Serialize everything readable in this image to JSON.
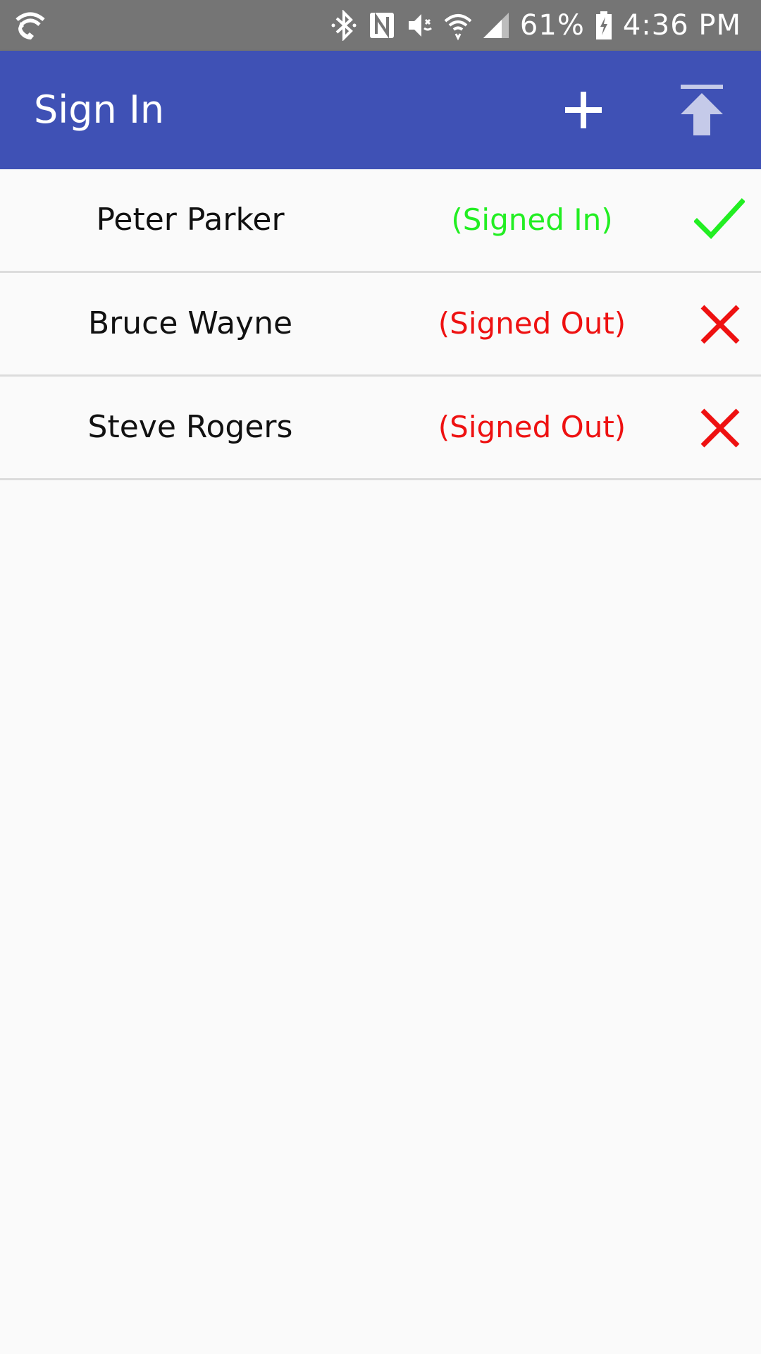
{
  "status_bar": {
    "battery": "61%",
    "time": "4:36 PM",
    "icons": [
      "wifi-calling-icon",
      "bluetooth-icon",
      "nfc-icon",
      "vibrate-icon",
      "wifi-icon",
      "signal-icon",
      "battery-charging-icon"
    ]
  },
  "app_bar": {
    "title": "Sign In",
    "actions": [
      "add-icon",
      "upload-icon"
    ],
    "color": "#3f51b5"
  },
  "people": [
    {
      "name": "Peter Parker",
      "status": "(Signed In)",
      "status_color": "#22ee22",
      "icon": "check-icon"
    },
    {
      "name": "Bruce Wayne",
      "status": "(Signed Out)",
      "status_color": "#ee1111",
      "icon": "close-icon"
    },
    {
      "name": "Steve Rogers",
      "status": "(Signed Out)",
      "status_color": "#ee1111",
      "icon": "close-icon"
    }
  ]
}
